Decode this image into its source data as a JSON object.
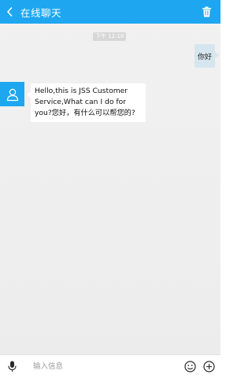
{
  "header": {
    "title": "在线聊天",
    "back_icon": "chevron-left-icon",
    "trash_icon": "trash-icon",
    "bar_color": "#1ea7f0"
  },
  "chat": {
    "time_badge": "下午 12:10",
    "messages": [
      {
        "direction": "outgoing",
        "text": "你好"
      },
      {
        "direction": "incoming",
        "avatar_icon": "user-icon",
        "text": "Hello,this is JSS Customer Service,What can I do for you?您好，有什么可以帮您的?"
      }
    ]
  },
  "input_bar": {
    "mic_icon": "microphone-icon",
    "placeholder": "输入信息",
    "value": "",
    "emoji_icon": "smiley-icon",
    "plus_icon": "plus-circle-icon"
  }
}
